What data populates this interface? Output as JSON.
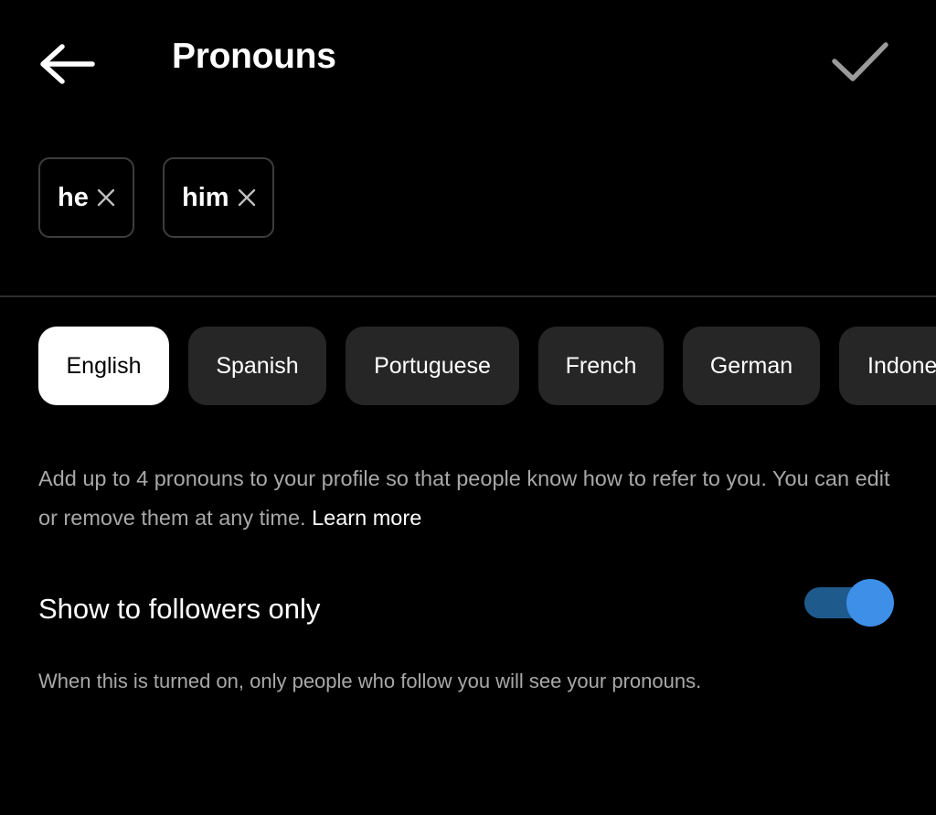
{
  "header": {
    "title": "Pronouns",
    "back_icon": "arrow-left-icon",
    "done_icon": "checkmark-icon"
  },
  "chips": [
    {
      "label": "he",
      "remove_icon": "close-icon"
    },
    {
      "label": "him",
      "remove_icon": "close-icon"
    }
  ],
  "languages": {
    "items": [
      "English",
      "Spanish",
      "Portuguese",
      "French",
      "German",
      "Indone"
    ],
    "selected": "English"
  },
  "description": {
    "text": "Add up to 4 pronouns to your profile so that people know how to refer to you. You can edit or remove them at any time.",
    "link": "Learn more"
  },
  "followers_toggle": {
    "label": "Show to followers only",
    "enabled": true,
    "hint": "When this is turned on, only people who follow you will see your pronouns."
  },
  "colors": {
    "background": "#000000",
    "chip_border": "#3d3d3d",
    "pill_bg": "#262626",
    "pill_selected_bg": "#ffffff",
    "secondary_text": "#a8a8a8",
    "toggle_track": "#1f5a8c",
    "toggle_thumb": "#3d8fe8"
  }
}
